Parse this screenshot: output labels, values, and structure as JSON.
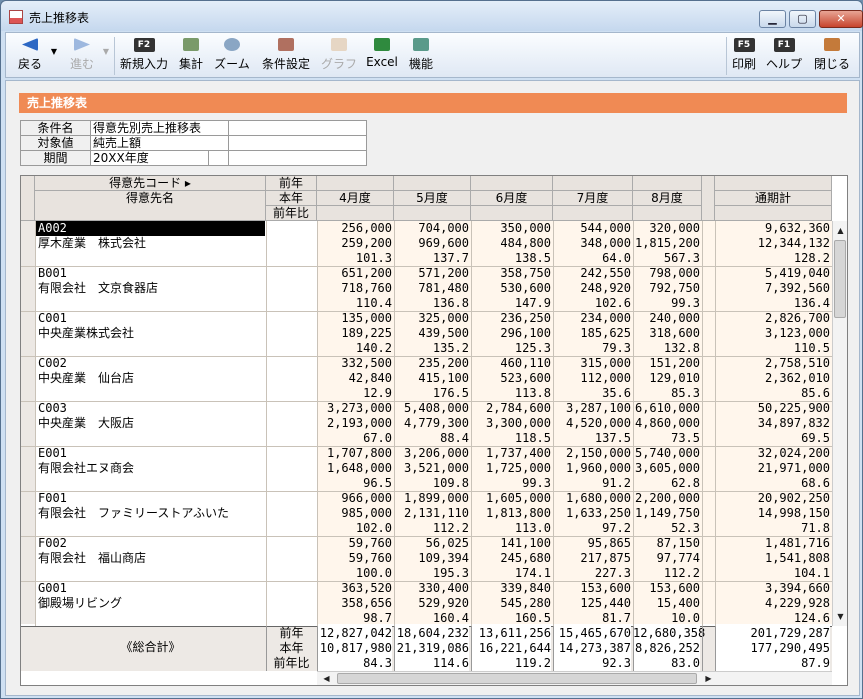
{
  "window": {
    "title": "売上推移表"
  },
  "toolbar": {
    "back": "戻る",
    "forward": "進む",
    "new_entry": "新規入力",
    "aggregate": "集計",
    "zoom": "ズーム",
    "condition": "条件設定",
    "graph": "グラフ",
    "excel": "Excel",
    "function": "機能",
    "print": "印刷",
    "help": "ヘルプ",
    "close": "閉じる",
    "fkey_new": "F2",
    "fkey_print": "F5",
    "fkey_help": "F1"
  },
  "report": {
    "title": "売上推移表"
  },
  "conditions": [
    {
      "label": "条件名",
      "value": "得意先別売上推移表"
    },
    {
      "label": "対象値",
      "value": "純売上額"
    },
    {
      "label": "期間",
      "value": "20XX年度"
    }
  ],
  "grid": {
    "header": {
      "code": "得意先コード",
      "name": "得意先名",
      "prev_year": "前年",
      "this_year": "本年",
      "ratio": "前年比",
      "months": [
        "4月度",
        "5月度",
        "6月度",
        "7月度",
        "8月度"
      ],
      "total": "通期計"
    },
    "customers": [
      {
        "code": "A002",
        "name": "厚木産業　株式会社",
        "rows": [
          [
            "256,000",
            "704,000",
            "350,000",
            "544,000",
            "320,000",
            "9,632,360"
          ],
          [
            "259,200",
            "969,600",
            "484,800",
            "348,000",
            "1,815,200",
            "12,344,132"
          ],
          [
            "101.3",
            "137.7",
            "138.5",
            "64.0",
            "567.3",
            "128.2"
          ]
        ]
      },
      {
        "code": "B001",
        "name": "有限会社　文京食器店",
        "rows": [
          [
            "651,200",
            "571,200",
            "358,750",
            "242,550",
            "798,000",
            "5,419,040"
          ],
          [
            "718,760",
            "781,480",
            "530,600",
            "248,920",
            "792,750",
            "7,392,560"
          ],
          [
            "110.4",
            "136.8",
            "147.9",
            "102.6",
            "99.3",
            "136.4"
          ]
        ]
      },
      {
        "code": "C001",
        "name": "中央産業株式会社",
        "rows": [
          [
            "135,000",
            "325,000",
            "236,250",
            "234,000",
            "240,000",
            "2,826,700"
          ],
          [
            "189,225",
            "439,500",
            "296,100",
            "185,625",
            "318,600",
            "3,123,000"
          ],
          [
            "140.2",
            "135.2",
            "125.3",
            "79.3",
            "132.8",
            "110.5"
          ]
        ]
      },
      {
        "code": "C002",
        "name": "中央産業　仙台店",
        "rows": [
          [
            "332,500",
            "235,200",
            "460,110",
            "315,000",
            "151,200",
            "2,758,510"
          ],
          [
            "42,840",
            "415,100",
            "523,600",
            "112,000",
            "129,010",
            "2,362,010"
          ],
          [
            "12.9",
            "176.5",
            "113.8",
            "35.6",
            "85.3",
            "85.6"
          ]
        ]
      },
      {
        "code": "C003",
        "name": "中央産業　大阪店",
        "rows": [
          [
            "3,273,000",
            "5,408,000",
            "2,784,600",
            "3,287,100",
            "6,610,000",
            "50,225,900"
          ],
          [
            "2,193,000",
            "4,779,300",
            "3,300,000",
            "4,520,000",
            "4,860,000",
            "34,897,832"
          ],
          [
            "67.0",
            "88.4",
            "118.5",
            "137.5",
            "73.5",
            "69.5"
          ]
        ]
      },
      {
        "code": "E001",
        "name": "有限会社エヌ商会",
        "rows": [
          [
            "1,707,800",
            "3,206,000",
            "1,737,400",
            "2,150,000",
            "5,740,000",
            "32,024,200"
          ],
          [
            "1,648,000",
            "3,521,000",
            "1,725,000",
            "1,960,000",
            "3,605,000",
            "21,971,000"
          ],
          [
            "96.5",
            "109.8",
            "99.3",
            "91.2",
            "62.8",
            "68.6"
          ]
        ]
      },
      {
        "code": "F001",
        "name": "有限会社　ファミリーストアふいた",
        "rows": [
          [
            "966,000",
            "1,899,000",
            "1,605,000",
            "1,680,000",
            "2,200,000",
            "20,902,250"
          ],
          [
            "985,000",
            "2,131,110",
            "1,813,800",
            "1,633,250",
            "1,149,750",
            "14,998,150"
          ],
          [
            "102.0",
            "112.2",
            "113.0",
            "97.2",
            "52.3",
            "71.8"
          ]
        ]
      },
      {
        "code": "F002",
        "name": "有限会社　福山商店",
        "rows": [
          [
            "59,760",
            "56,025",
            "141,100",
            "95,865",
            "87,150",
            "1,481,716"
          ],
          [
            "59,760",
            "109,394",
            "245,680",
            "217,875",
            "97,774",
            "1,541,808"
          ],
          [
            "100.0",
            "195.3",
            "174.1",
            "227.3",
            "112.2",
            "104.1"
          ]
        ]
      },
      {
        "code": "G001",
        "name": "御殿場リビング",
        "rows": [
          [
            "363,520",
            "330,400",
            "339,840",
            "153,600",
            "153,600",
            "3,394,660"
          ],
          [
            "358,656",
            "529,920",
            "545,280",
            "125,440",
            "15,400",
            "4,229,928"
          ],
          [
            "98.7",
            "160.4",
            "160.5",
            "81.7",
            "10.0",
            "124.6"
          ]
        ]
      }
    ],
    "total": {
      "label": "《総合計》",
      "rows": [
        [
          "12,827,042",
          "18,604,232",
          "13,611,256",
          "15,465,670",
          "12,680,358",
          "201,729,287"
        ],
        [
          "10,817,980",
          "21,319,086",
          "16,221,644",
          "14,273,387",
          "8,826,252",
          "177,290,495"
        ],
        [
          "84.3",
          "114.6",
          "119.2",
          "92.3",
          "83.0",
          "87.9"
        ]
      ]
    }
  }
}
